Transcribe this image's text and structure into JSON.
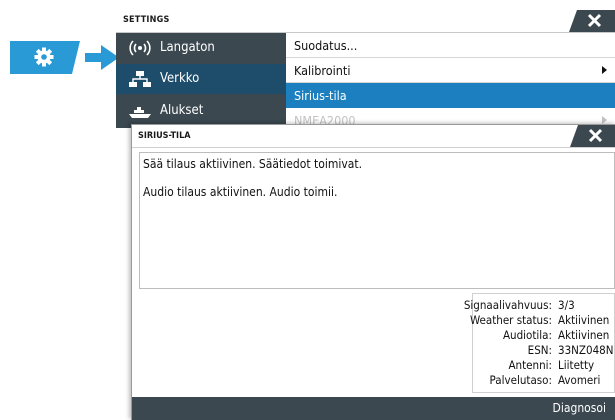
{
  "launcher": {
    "icon": "gear-icon",
    "arrow_icon": "arrow-right-icon"
  },
  "settings": {
    "title": "SETTINGS",
    "close_icon": "close-icon",
    "sidebar": [
      {
        "label": "Langaton",
        "icon": "wireless-icon"
      },
      {
        "label": "Verkko",
        "icon": "network-icon"
      },
      {
        "label": "Alukset",
        "icon": "vessels-icon"
      }
    ],
    "menu": [
      {
        "label": "Suodatus..."
      },
      {
        "label": "Kalibrointi"
      },
      {
        "label": "Sirius-tila"
      },
      {
        "label": "NMEA2000"
      }
    ]
  },
  "dialog": {
    "title": "SIRIUS-TILA",
    "messages": [
      "Sää tilaus aktiivinen. Säätiedot toimivat.",
      "Audio tilaus aktiivinen. Audio toimii."
    ],
    "info": [
      {
        "key": "Signaalivahvuus:",
        "value": "3/3"
      },
      {
        "key": "Weather status:",
        "value": "Aktiivinen"
      },
      {
        "key": "Audiotila:",
        "value": "Aktiivinen"
      },
      {
        "key": "ESN:",
        "value": "33NZ048N"
      },
      {
        "key": "Antenni:",
        "value": "Liitetty"
      },
      {
        "key": "Palvelutaso:",
        "value": "Avomeri"
      }
    ],
    "footer_button": "Diagnosoi"
  },
  "colors": {
    "dark_panel": "#3b4850",
    "selected_side": "#1d4d6b",
    "accent_blue": "#1b7fc0",
    "launcher_blue": "#2a9ad6"
  }
}
